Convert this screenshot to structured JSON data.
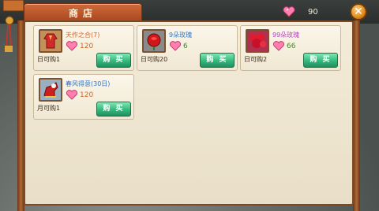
{
  "header": {
    "title": "商店"
  },
  "currency": {
    "icon": "heart-gems-icon",
    "value": "90"
  },
  "colors": {
    "orange_name": "#e0601c",
    "blue_name": "#2c74c8",
    "purple_name": "#b23fbf",
    "price_orange": "#d4641c",
    "price_green": "#3a8a20",
    "buy_green": "#34b87a"
  },
  "items": [
    {
      "name": "天作之合(7)",
      "price": "120",
      "limit": "日可购1",
      "buy_label": "购 买",
      "icon": "red-outfit-icon"
    },
    {
      "name": "9朵玫瑰",
      "price": "6",
      "limit": "日可购20",
      "buy_label": "购 买",
      "icon": "rose-icon"
    },
    {
      "name": "99朵玫瑰",
      "price": "66",
      "limit": "日可购2",
      "buy_label": "购 买",
      "icon": "rose-bouquet-icon"
    },
    {
      "name": "春风得意(30日)",
      "price": "120",
      "limit": "月可购1",
      "buy_label": "购 买",
      "icon": "red-mount-icon"
    }
  ]
}
